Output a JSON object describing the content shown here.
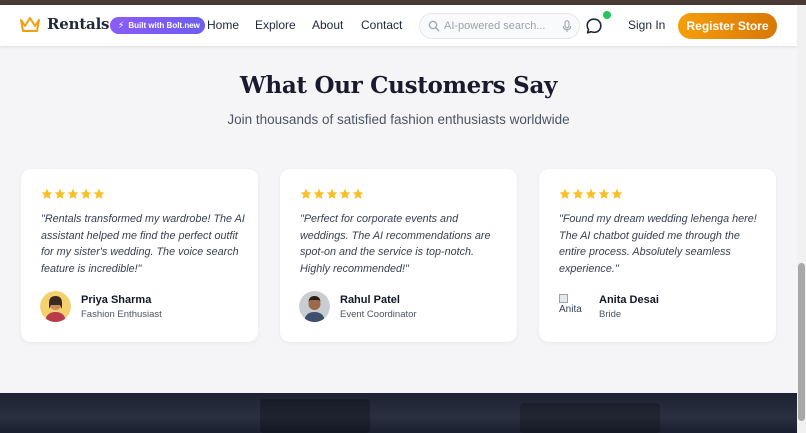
{
  "nav": {
    "brand": "Rentals",
    "badge": "Built with Bolt.new",
    "links": [
      "Home",
      "Explore",
      "About",
      "Contact"
    ],
    "search_placeholder": "AI-powered search...",
    "sign_in": "Sign In",
    "register": "Register Store"
  },
  "testimonials": {
    "title": "What Our Customers Say",
    "subtitle": "Join thousands of satisfied fashion enthusiasts worldwide",
    "items": [
      {
        "quote": "\"Rentals transformed my wardrobe! The AI assistant helped me find the perfect outfit for my sister's wedding. The voice search feature is incredible!\"",
        "name": "Priya Sharma",
        "role": "Fashion Enthusiast",
        "rating": 5
      },
      {
        "quote": "\"Perfect for corporate events and weddings. The AI recommendations are spot-on and the service is top-notch. Highly recommended!\"",
        "name": "Rahul Patel",
        "role": "Event Coordinator",
        "rating": 5
      },
      {
        "quote": "\"Found my dream wedding lehenga here! The AI chatbot guided me through the entire process. Absolutely seamless experience.\"",
        "name": "Anita Desai",
        "role": "Bride",
        "avatar_alt": "Anita",
        "rating": 5
      }
    ]
  },
  "colors": {
    "accent": "#f59e0b",
    "star": "#fbbf24",
    "badge": "#8b5cf6",
    "notification": "#22c55e"
  },
  "icons": [
    "crown-icon",
    "bolt-icon",
    "search-icon",
    "mic-icon",
    "chat-icon",
    "star-icon"
  ]
}
